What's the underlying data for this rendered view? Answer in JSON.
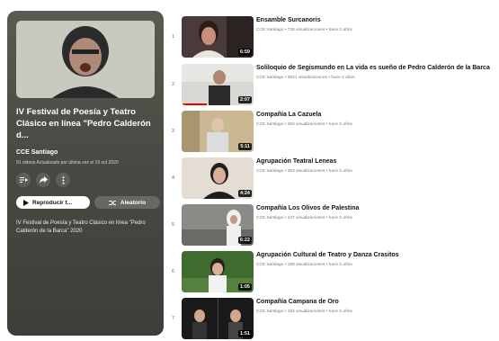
{
  "playlist": {
    "title": "IV Festival de Poesía y Teatro Clásico en línea \"Pedro Calderón d...",
    "channel": "CCE Santiago",
    "meta": "91 videos  Actualizado por última vez el 15 oct 2020",
    "play_label": "Reproducir t...",
    "shuffle_label": "Aleatorio",
    "description": "IV Festival de Poesía y Teatro Clásico en línea \"Pedro Calderón de la Barca\" 2020"
  },
  "videos": [
    {
      "index": "1",
      "title": "Ensamble Surcanoris",
      "meta": "CCE Santiago • 735 visualizaciones • hace 2 años",
      "duration": "6:59",
      "progress": 0
    },
    {
      "index": "2",
      "title": "Soliloquio de Segismundo en La vida es sueño de Pedro Calderón de la Barca",
      "meta": "CCE Santiago • 3921 visualizaciones • hace 2 años",
      "duration": "2:07",
      "progress": 0.35
    },
    {
      "index": "3",
      "title": "Compañía La Cazuela",
      "meta": "CCE Santiago • 366 visualizaciones • hace 2 años",
      "duration": "5:11",
      "progress": 0
    },
    {
      "index": "4",
      "title": "Agrupación Teatral Leneas",
      "meta": "CCE Santiago • 353 visualizaciones • hace 2 años",
      "duration": "4:24",
      "progress": 0
    },
    {
      "index": "5",
      "title": "Compañía Los Olivos de Palestina",
      "meta": "CCE Santiago • 247 visualizaciones • hace 2 años",
      "duration": "6:22",
      "progress": 0
    },
    {
      "index": "6",
      "title": "Agrupación Cultural de Teatro y Danza Crasitos",
      "meta": "CCE Santiago • 188 visualizaciones • hace 2 años",
      "duration": "1:05",
      "progress": 0
    },
    {
      "index": "7",
      "title": "Compañía Campana de Oro",
      "meta": "CCE Santiago • 194 visualizaciones • hace 2 años",
      "duration": "1:51",
      "progress": 0
    }
  ],
  "icons": [
    "add-to-queue-icon",
    "share-icon",
    "more-options-icon",
    "play-icon",
    "shuffle-icon"
  ]
}
